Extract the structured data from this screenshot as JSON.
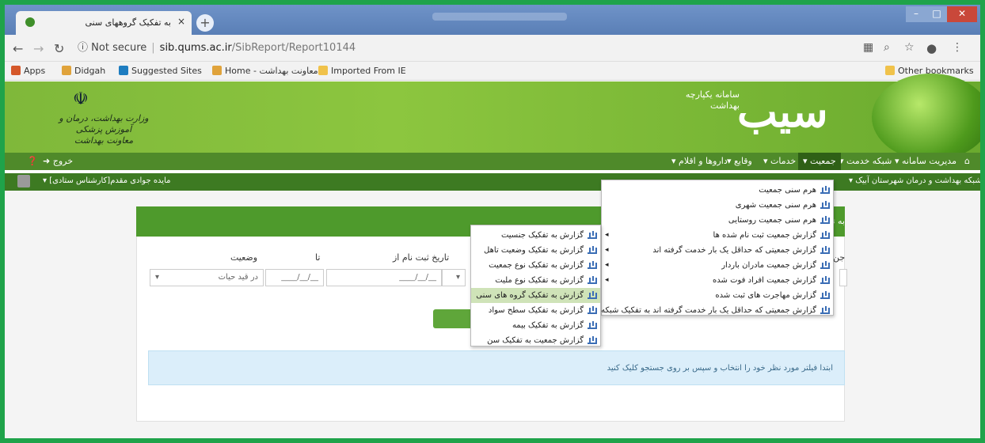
{
  "browser": {
    "tab_title": "به تفکیک گروههای سنی",
    "tab_close": "×",
    "new_tab": "+",
    "url_security": "Not secure",
    "url_host": "sib.qums.ac.ir",
    "url_path": "/SibReport/Report10144",
    "bookmarks": [
      "Apps",
      "Didgah",
      "Suggested Sites",
      "Home - معاونت بهداشت",
      "Imported From IE"
    ],
    "other_bookmarks": "Other bookmarks"
  },
  "banner": {
    "ministry_text": "وزارت بهداشت، درمان و آموزش پزشکی\nمعاونت بهداشت",
    "logo_text": "سیب",
    "logo_sub": "سامانه یکپارچه بهداشت"
  },
  "menubar": {
    "home_icon": "home-icon",
    "items": [
      "مدیریت سامانه",
      "شبکه خدمت",
      "جمعیت",
      "خدمات",
      "وقایع",
      "داروها و اقلام"
    ],
    "logout": "خروج",
    "help_icon": "help-icon"
  },
  "bar2": {
    "facility": "شبکه بهداشت و درمان شهرستان آبیک",
    "user": "مایده جوادی مقدم[کارشناس ستادی]"
  },
  "panel": {
    "head_partial": "به تف",
    "label_cut": "جن",
    "reg_date_from": "تاریخ ثبت نام از",
    "to": "تا",
    "status": "وضعیت",
    "status_value": "در قید حیات",
    "date_placeholder": "__/__/____",
    "info": "ابتدا فیلتر مورد نظر خود را انتخاب و سپس بر روی جستجو کلیک کنید"
  },
  "population_menu": [
    "هرم سنی جمعیت",
    "هرم سنی جمعیت شهری",
    "هرم سنی جمعیت روستایی",
    "گزارش جمعیت ثبت نام شده ها",
    "گزارش جمعیتی که حداقل یک بار خدمت گرفته اند",
    "گزارش جمعیت مادران باردار",
    "گزارش جمعیت افراد فوت شده",
    "گزارش مهاجرت های ثبت شده",
    "گزارش جمعیتی که حداقل یک بار خدمت گرفته اند به تفکیک شبکه"
  ],
  "report_submenu": [
    "گزارش به تفکیک جنسیت",
    "گزارش به تفکیک وضعیت تاهل",
    "گزارش به تفکیک نوع جمعیت",
    "گزارش به تفکیک نوع ملیت",
    "گزارش به تفکیک گروه های سنی",
    "گزارش به تفکیک سطح سواد",
    "گزارش به تفکیک بیمه",
    "گزارش جمعیت به تفکیک سن"
  ],
  "colors": {
    "brand_green": "#4f8a2a",
    "highlight": "#cfe3b8",
    "info_bg": "#dbeefa",
    "outer_border": "#1fa34a"
  }
}
